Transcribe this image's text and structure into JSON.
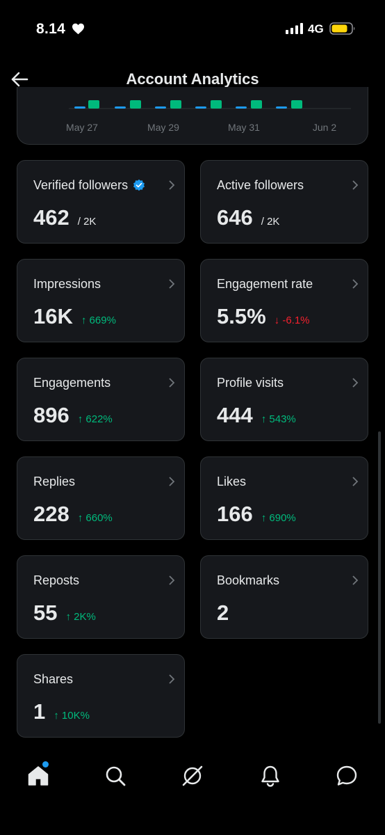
{
  "status_bar": {
    "time": "8.14",
    "network": "4G",
    "battery_color": "#ffd60a"
  },
  "header": {
    "title": "Account Analytics",
    "back_icon": "arrow-left-icon"
  },
  "chart": {
    "x_ticks": [
      "May 27",
      "May 29",
      "May 31",
      "Jun 2"
    ],
    "series_colors": [
      "#1d9bf0",
      "#00ba7c"
    ]
  },
  "stats": [
    {
      "label": "Verified followers",
      "value": "462",
      "sub": "/ 2K",
      "verified": true
    },
    {
      "label": "Active followers",
      "value": "646",
      "sub": "/ 2K"
    },
    {
      "label": "Impressions",
      "value": "16K",
      "change": "↑ 669%",
      "direction": "up"
    },
    {
      "label": "Engagement rate",
      "value": "5.5%",
      "change": "↓ -6.1%",
      "direction": "down"
    },
    {
      "label": "Engagements",
      "value": "896",
      "change": "↑ 622%",
      "direction": "up"
    },
    {
      "label": "Profile visits",
      "value": "444",
      "change": "↑ 543%",
      "direction": "up"
    },
    {
      "label": "Replies",
      "value": "228",
      "change": "↑ 660%",
      "direction": "up"
    },
    {
      "label": "Likes",
      "value": "166",
      "change": "↑ 690%",
      "direction": "up"
    },
    {
      "label": "Reposts",
      "value": "55",
      "change": "↑ 2K%",
      "direction": "up"
    },
    {
      "label": "Bookmarks",
      "value": "2"
    },
    {
      "label": "Shares",
      "value": "1",
      "change": "↑ 10K%",
      "direction": "up"
    }
  ],
  "bottom_nav": [
    "home-icon",
    "search-icon",
    "grok-icon",
    "notifications-icon",
    "messages-icon"
  ],
  "colors": {
    "background": "#000000",
    "card": "#16181c",
    "border": "#2f3336",
    "text": "#e7e9ea",
    "muted": "#71767b",
    "up": "#00ba7c",
    "down": "#f4212e",
    "accent": "#1d9bf0"
  }
}
